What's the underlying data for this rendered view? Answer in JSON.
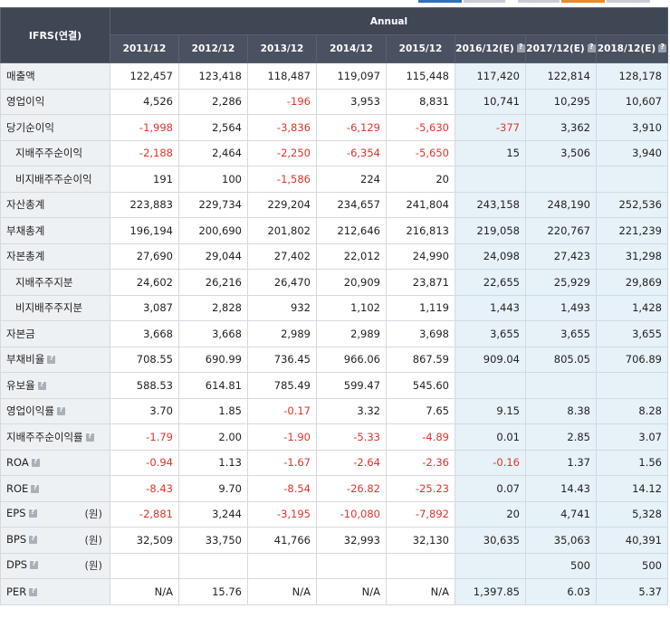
{
  "table": {
    "corner_label": "IFRS(연결)",
    "group_label": "Annual",
    "columns": [
      {
        "label": "2011/12",
        "estimate": false
      },
      {
        "label": "2012/12",
        "estimate": false
      },
      {
        "label": "2013/12",
        "estimate": false
      },
      {
        "label": "2014/12",
        "estimate": false
      },
      {
        "label": "2015/12",
        "estimate": false
      },
      {
        "label": "2016/12(E)",
        "estimate": true
      },
      {
        "label": "2017/12(E)",
        "estimate": true
      },
      {
        "label": "2018/12(E)",
        "estimate": true
      }
    ],
    "rows": [
      {
        "label": "매출액",
        "indent": false,
        "help": false,
        "unit": "",
        "values": [
          "122,457",
          "123,418",
          "118,487",
          "119,097",
          "115,448",
          "117,420",
          "122,814",
          "128,178"
        ]
      },
      {
        "label": "영업이익",
        "indent": false,
        "help": false,
        "unit": "",
        "values": [
          "4,526",
          "2,286",
          "-196",
          "3,953",
          "8,831",
          "10,741",
          "10,295",
          "10,607"
        ]
      },
      {
        "label": "당기순이익",
        "indent": false,
        "help": false,
        "unit": "",
        "values": [
          "-1,998",
          "2,564",
          "-3,836",
          "-6,129",
          "-5,630",
          "-377",
          "3,362",
          "3,910"
        ]
      },
      {
        "label": "지배주주순이익",
        "indent": true,
        "help": false,
        "unit": "",
        "values": [
          "-2,188",
          "2,464",
          "-2,250",
          "-6,354",
          "-5,650",
          "15",
          "3,506",
          "3,940"
        ]
      },
      {
        "label": "비지배주주순이익",
        "indent": true,
        "help": false,
        "unit": "",
        "values": [
          "191",
          "100",
          "-1,586",
          "224",
          "20",
          "",
          "",
          ""
        ]
      },
      {
        "label": "자산총계",
        "indent": false,
        "help": false,
        "unit": "",
        "values": [
          "223,883",
          "229,734",
          "229,204",
          "234,657",
          "241,804",
          "243,158",
          "248,190",
          "252,536"
        ]
      },
      {
        "label": "부채총계",
        "indent": false,
        "help": false,
        "unit": "",
        "values": [
          "196,194",
          "200,690",
          "201,802",
          "212,646",
          "216,813",
          "219,058",
          "220,767",
          "221,239"
        ]
      },
      {
        "label": "자본총계",
        "indent": false,
        "help": false,
        "unit": "",
        "values": [
          "27,690",
          "29,044",
          "27,402",
          "22,012",
          "24,990",
          "24,098",
          "27,423",
          "31,298"
        ]
      },
      {
        "label": "지배주주지분",
        "indent": true,
        "help": false,
        "unit": "",
        "values": [
          "24,602",
          "26,216",
          "26,470",
          "20,909",
          "23,871",
          "22,655",
          "25,929",
          "29,869"
        ]
      },
      {
        "label": "비지배주주지분",
        "indent": true,
        "help": false,
        "unit": "",
        "values": [
          "3,087",
          "2,828",
          "932",
          "1,102",
          "1,119",
          "1,443",
          "1,493",
          "1,428"
        ]
      },
      {
        "label": "자본금",
        "indent": false,
        "help": false,
        "unit": "",
        "values": [
          "3,668",
          "3,668",
          "2,989",
          "2,989",
          "3,698",
          "3,655",
          "3,655",
          "3,655"
        ]
      },
      {
        "label": "부채비율",
        "indent": false,
        "help": true,
        "unit": "",
        "values": [
          "708.55",
          "690.99",
          "736.45",
          "966.06",
          "867.59",
          "909.04",
          "805.05",
          "706.89"
        ]
      },
      {
        "label": "유보율",
        "indent": false,
        "help": true,
        "unit": "",
        "values": [
          "588.53",
          "614.81",
          "785.49",
          "599.47",
          "545.60",
          "",
          "",
          ""
        ]
      },
      {
        "label": "영업이익률",
        "indent": false,
        "help": true,
        "unit": "",
        "values": [
          "3.70",
          "1.85",
          "-0.17",
          "3.32",
          "7.65",
          "9.15",
          "8.38",
          "8.28"
        ]
      },
      {
        "label": "지배주주순이익률",
        "indent": false,
        "help": true,
        "unit": "",
        "values": [
          "-1.79",
          "2.00",
          "-1.90",
          "-5.33",
          "-4.89",
          "0.01",
          "2.85",
          "3.07"
        ]
      },
      {
        "label": "ROA",
        "indent": false,
        "help": true,
        "unit": "",
        "values": [
          "-0.94",
          "1.13",
          "-1.67",
          "-2.64",
          "-2.36",
          "-0.16",
          "1.37",
          "1.56"
        ]
      },
      {
        "label": "ROE",
        "indent": false,
        "help": true,
        "unit": "",
        "values": [
          "-8.43",
          "9.70",
          "-8.54",
          "-26.82",
          "-25.23",
          "0.07",
          "14.43",
          "14.12"
        ]
      },
      {
        "label": "EPS",
        "indent": false,
        "help": true,
        "unit": "(원)",
        "values": [
          "-2,881",
          "3,244",
          "-3,195",
          "-10,080",
          "-7,892",
          "20",
          "4,741",
          "5,328"
        ]
      },
      {
        "label": "BPS",
        "indent": false,
        "help": true,
        "unit": "(원)",
        "values": [
          "32,509",
          "33,750",
          "41,766",
          "32,993",
          "32,130",
          "30,635",
          "35,063",
          "40,391"
        ]
      },
      {
        "label": "DPS",
        "indent": false,
        "help": true,
        "unit": "(원)",
        "values": [
          "",
          "",
          "",
          "",
          "",
          "",
          "500",
          "500"
        ]
      },
      {
        "label": "PER",
        "indent": false,
        "help": true,
        "unit": "",
        "values": [
          "N/A",
          "15.76",
          "N/A",
          "N/A",
          "N/A",
          "1,397.85",
          "6.03",
          "5.37"
        ]
      }
    ]
  },
  "colors": {
    "header_bg": "#3f4654",
    "label_bg": "#eef1f4",
    "estimate_bg": "#e6f1f8",
    "negative": "#e0342c",
    "tab_blue": "#2f6fc4",
    "tab_orange": "#e98a2b"
  },
  "icons": {
    "help": "help-icon"
  }
}
